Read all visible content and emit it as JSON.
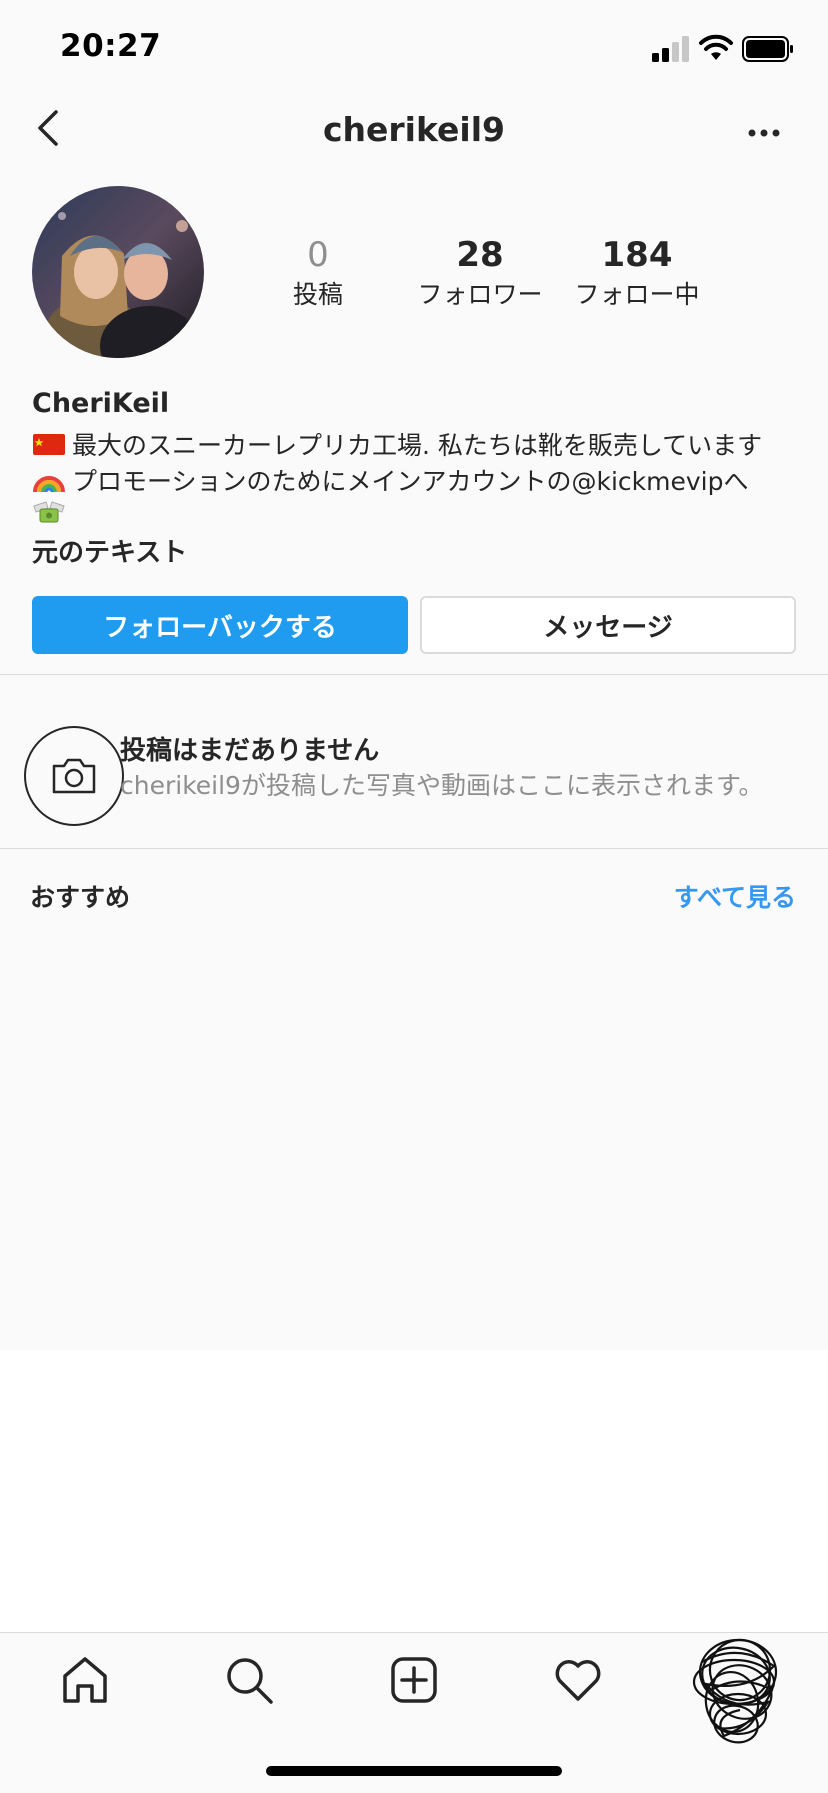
{
  "status_bar": {
    "time": "20:27"
  },
  "nav": {
    "username": "cherikeil9"
  },
  "profile": {
    "stats": [
      {
        "value": "0",
        "label": "投稿"
      },
      {
        "value": "28",
        "label": "フォロワー"
      },
      {
        "value": "184",
        "label": "フォロー中"
      }
    ],
    "display_name": "CheriKeil",
    "bio_lines": [
      "最大のスニーカーレプリカ工場. 私たちは靴を販売しています",
      "プロモーションのためにメインアカウントの@kickmevipへ"
    ],
    "translate_label": "元のテキスト",
    "follow_back_label": "フォローバックする",
    "message_label": "メッセージ"
  },
  "empty_posts": {
    "title": "投稿はまだありません",
    "subtitle": "cherikeil9が投稿した写真や動画はここに表示されます。"
  },
  "recommendations": {
    "title": "おすすめ",
    "see_all_label": "すべて見る"
  },
  "tab_bar": {
    "items": [
      "home-icon",
      "search-icon",
      "new-post-icon",
      "activity-heart-icon",
      "profile-avatar"
    ]
  },
  "colors": {
    "accent": "#1f9bf0",
    "link": "#3897f0",
    "text": "#262626",
    "secondary_text": "#8e8e8e",
    "divider": "#dbdbdb"
  }
}
